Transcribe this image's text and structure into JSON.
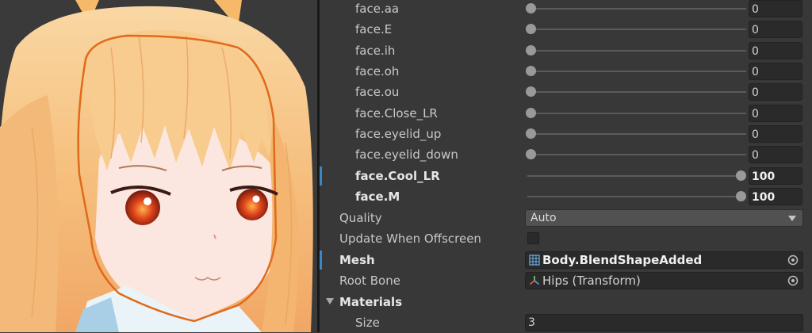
{
  "blendshapes": [
    {
      "label": "face.aa",
      "value": "0",
      "slider_fraction": 0,
      "modified": false
    },
    {
      "label": "face.E",
      "value": "0",
      "slider_fraction": 0,
      "modified": false
    },
    {
      "label": "face.ih",
      "value": "0",
      "slider_fraction": 0,
      "modified": false
    },
    {
      "label": "face.oh",
      "value": "0",
      "slider_fraction": 0,
      "modified": false
    },
    {
      "label": "face.ou",
      "value": "0",
      "slider_fraction": 0,
      "modified": false
    },
    {
      "label": "face.Close_LR",
      "value": "0",
      "slider_fraction": 0,
      "modified": false
    },
    {
      "label": "face.eyelid_up",
      "value": "0",
      "slider_fraction": 0,
      "modified": false
    },
    {
      "label": "face.eyelid_down",
      "value": "0",
      "slider_fraction": 0,
      "modified": false
    },
    {
      "label": "face.Cool_LR",
      "value": "100",
      "slider_fraction": 1,
      "modified": true
    },
    {
      "label": "face.M",
      "value": "100",
      "slider_fraction": 1,
      "modified": true
    }
  ],
  "quality": {
    "label": "Quality",
    "value": "Auto"
  },
  "update_offscreen": {
    "label": "Update When Offscreen",
    "checked": false
  },
  "mesh": {
    "label": "Mesh",
    "value": "Body.BlendShapeAdded",
    "icon": "mesh-grid-icon",
    "modified": true
  },
  "root_bone": {
    "label": "Root Bone",
    "value": "Hips (Transform)",
    "icon": "transform-axes-icon"
  },
  "materials": {
    "label": "Materials",
    "expanded": true
  },
  "size": {
    "label": "Size",
    "value": "3"
  },
  "colors": {
    "modified_bar": "#3d87c9",
    "hair": "#f5bf7c",
    "outline": "#e06a1a",
    "eye": "#c83a1a"
  }
}
